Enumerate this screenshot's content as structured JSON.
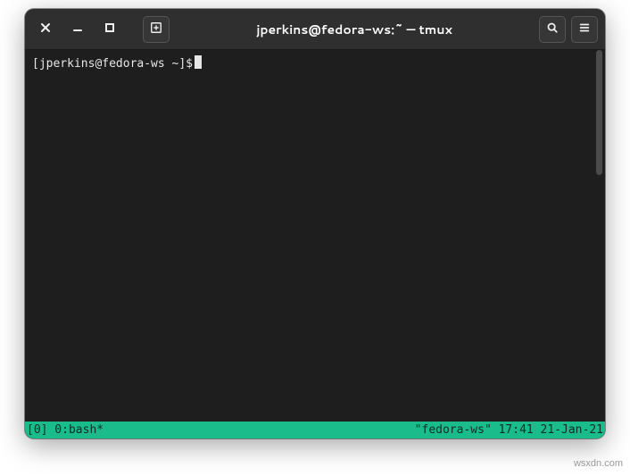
{
  "titlebar": {
    "title": "jperkins@fedora-ws:~ — tmux",
    "icons": {
      "close": "close-icon",
      "minimize": "minimize-icon",
      "maximize": "maximize-icon",
      "newtab": "new-tab-icon",
      "search": "search-icon",
      "menu": "hamburger-menu-icon"
    }
  },
  "terminal": {
    "prompt": "[jperkins@fedora-ws ~]$"
  },
  "tmux": {
    "left": "[0] 0:bash*",
    "right": "\"fedora-ws\" 17:41 21-Jan-21"
  },
  "watermark": "wsxdn.com"
}
